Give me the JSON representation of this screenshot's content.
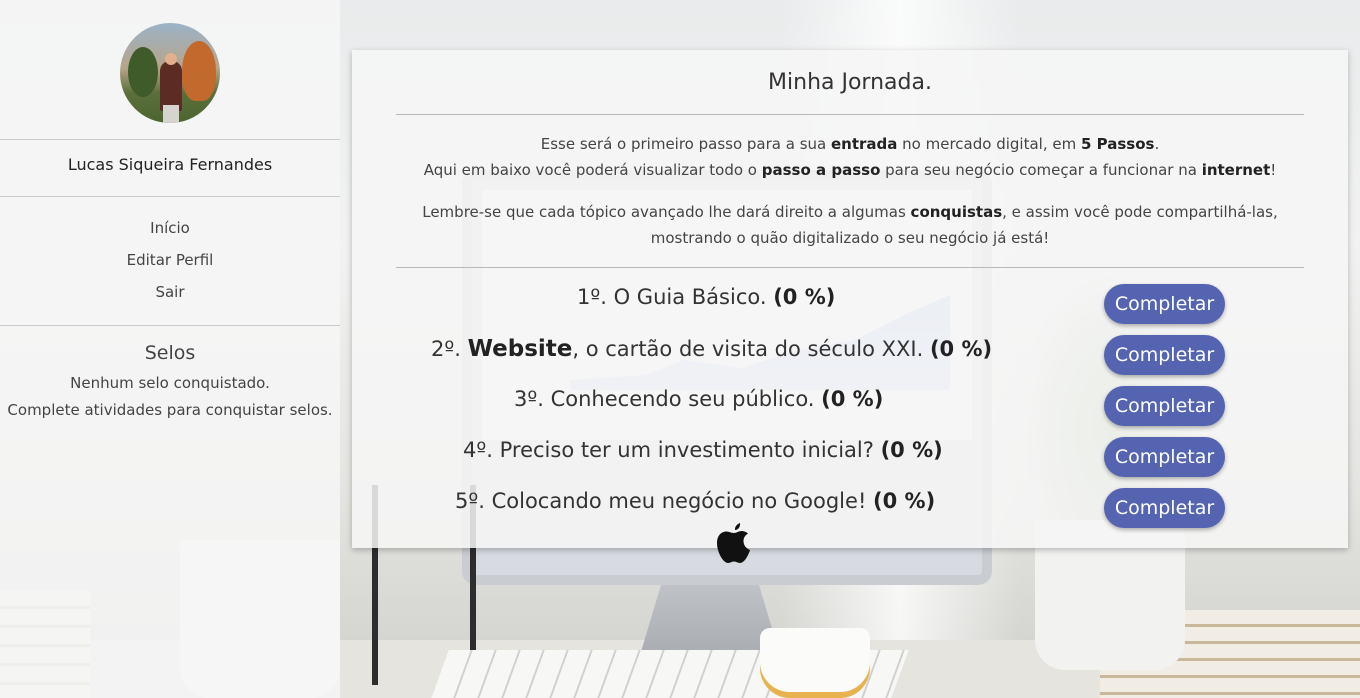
{
  "sidebar": {
    "user_name": "Lucas Siqueira Fernandes",
    "nav": [
      {
        "label": "Início"
      },
      {
        "label": "Editar Perfil"
      },
      {
        "label": "Sair"
      }
    ],
    "selos": {
      "title": "Selos",
      "line1": "Nenhum selo conquistado.",
      "line2": "Complete atividades para conquistar selos."
    }
  },
  "main": {
    "title": "Minha Jornada.",
    "intro": {
      "p1_a": "Esse será o primeiro passo para a sua ",
      "p1_b": "entrada",
      "p1_c": " no mercado digital, em ",
      "p1_d": "5 Passos",
      "p1_e": ".",
      "p2_a": "Aqui em baixo você poderá visualizar todo o ",
      "p2_b": "passo a passo",
      "p2_c": " para seu negócio começar a funcionar na ",
      "p2_d": "internet",
      "p2_e": "!",
      "p3_a": "Lembre-se que cada tópico avançado lhe dará direito a algumas ",
      "p3_b": "conquistas",
      "p3_c": ", e assim você pode compartilhá-las,",
      "p3_d": "mostrando o quão digitalizado o seu negócio já está!"
    },
    "steps": [
      {
        "prefix": "1º. O Guia Básico. ",
        "bold": "",
        "suffix": "",
        "progress": "(0 %)",
        "button": "Completar"
      },
      {
        "prefix": "2º. ",
        "bold": "Website",
        "suffix": ", o cartão de visita do século XXI. ",
        "progress": "(0 %)",
        "button": "Completar"
      },
      {
        "prefix": "3º. Conhecendo seu público. ",
        "bold": "",
        "suffix": "",
        "progress": "(0 %)",
        "button": "Completar"
      },
      {
        "prefix": "4º. Preciso ter um investimento inicial? ",
        "bold": "",
        "suffix": "",
        "progress": "(0 %)",
        "button": "Completar"
      },
      {
        "prefix": "5º. Colocando meu negócio no Google! ",
        "bold": "",
        "suffix": "",
        "progress": "(0 %)",
        "button": "Completar"
      }
    ]
  },
  "colors": {
    "button": "#5464b0",
    "panel": "#f6f6f6"
  },
  "icons": {
    "logo": "apple-logo-icon"
  }
}
